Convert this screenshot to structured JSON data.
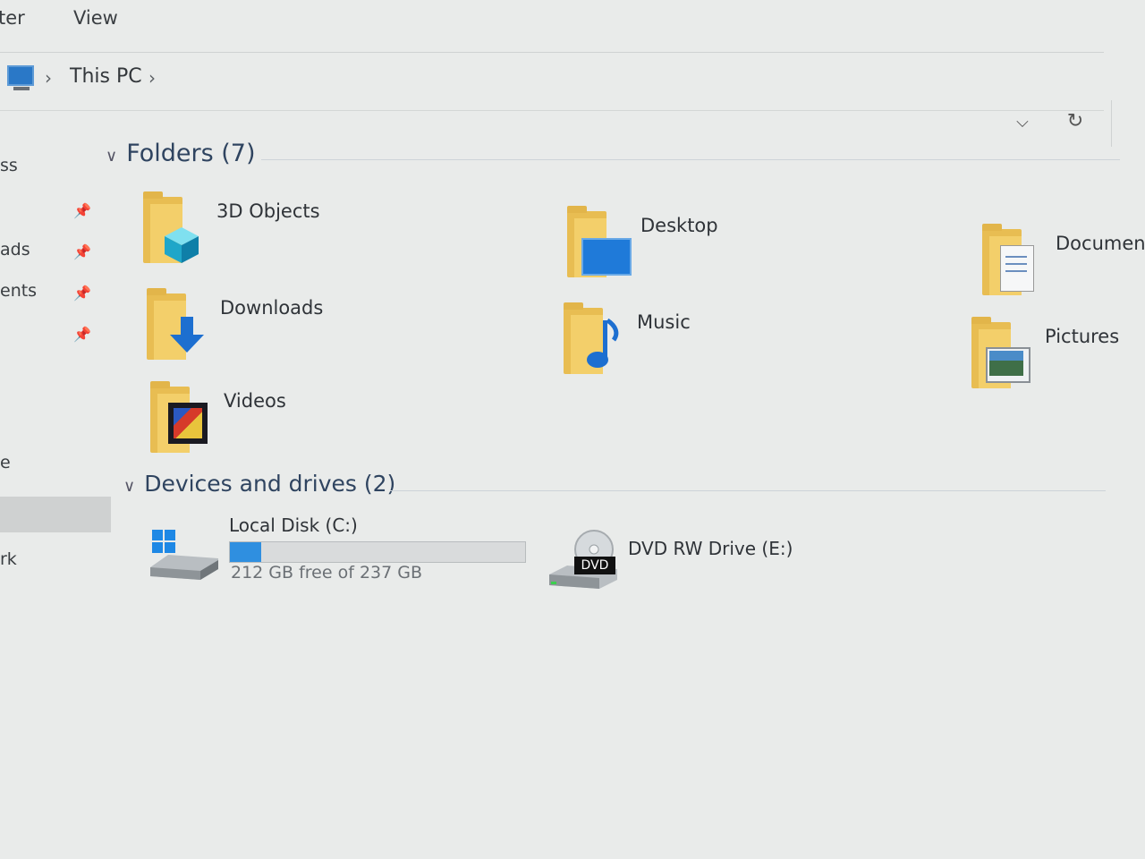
{
  "ribbon": {
    "tabs": [
      {
        "label": "ter"
      },
      {
        "label": "View"
      }
    ]
  },
  "address": {
    "crumbs": [
      {
        "label": "This PC"
      }
    ],
    "separator": "›"
  },
  "nav": {
    "items": [
      {
        "label": "ss"
      },
      {
        "label": "ads"
      },
      {
        "label": "ents"
      },
      {
        "label": "e"
      },
      {
        "label": "rk"
      }
    ]
  },
  "folders": {
    "header": "Folders (7)",
    "items": [
      {
        "label": "3D Objects",
        "icon": "3d-objects-folder-icon"
      },
      {
        "label": "Desktop",
        "icon": "desktop-folder-icon"
      },
      {
        "label": "Documents",
        "icon": "documents-folder-icon"
      },
      {
        "label": "Downloads",
        "icon": "downloads-folder-icon"
      },
      {
        "label": "Music",
        "icon": "music-folder-icon"
      },
      {
        "label": "Pictures",
        "icon": "pictures-folder-icon"
      },
      {
        "label": "Videos",
        "icon": "videos-folder-icon"
      }
    ]
  },
  "drives": {
    "header": "Devices and drives (2)",
    "items": [
      {
        "label": "Local Disk (C:)",
        "free_text": "212 GB free of 237 GB",
        "used_fraction": 0.105,
        "icon": "local-disk-icon"
      },
      {
        "label": "DVD RW Drive (E:)",
        "icon": "dvd-drive-icon",
        "badge": "DVD"
      }
    ]
  },
  "colors": {
    "accent": "#2f8fe0",
    "folder": "#f3cf6a",
    "header_text": "#2f4460"
  }
}
